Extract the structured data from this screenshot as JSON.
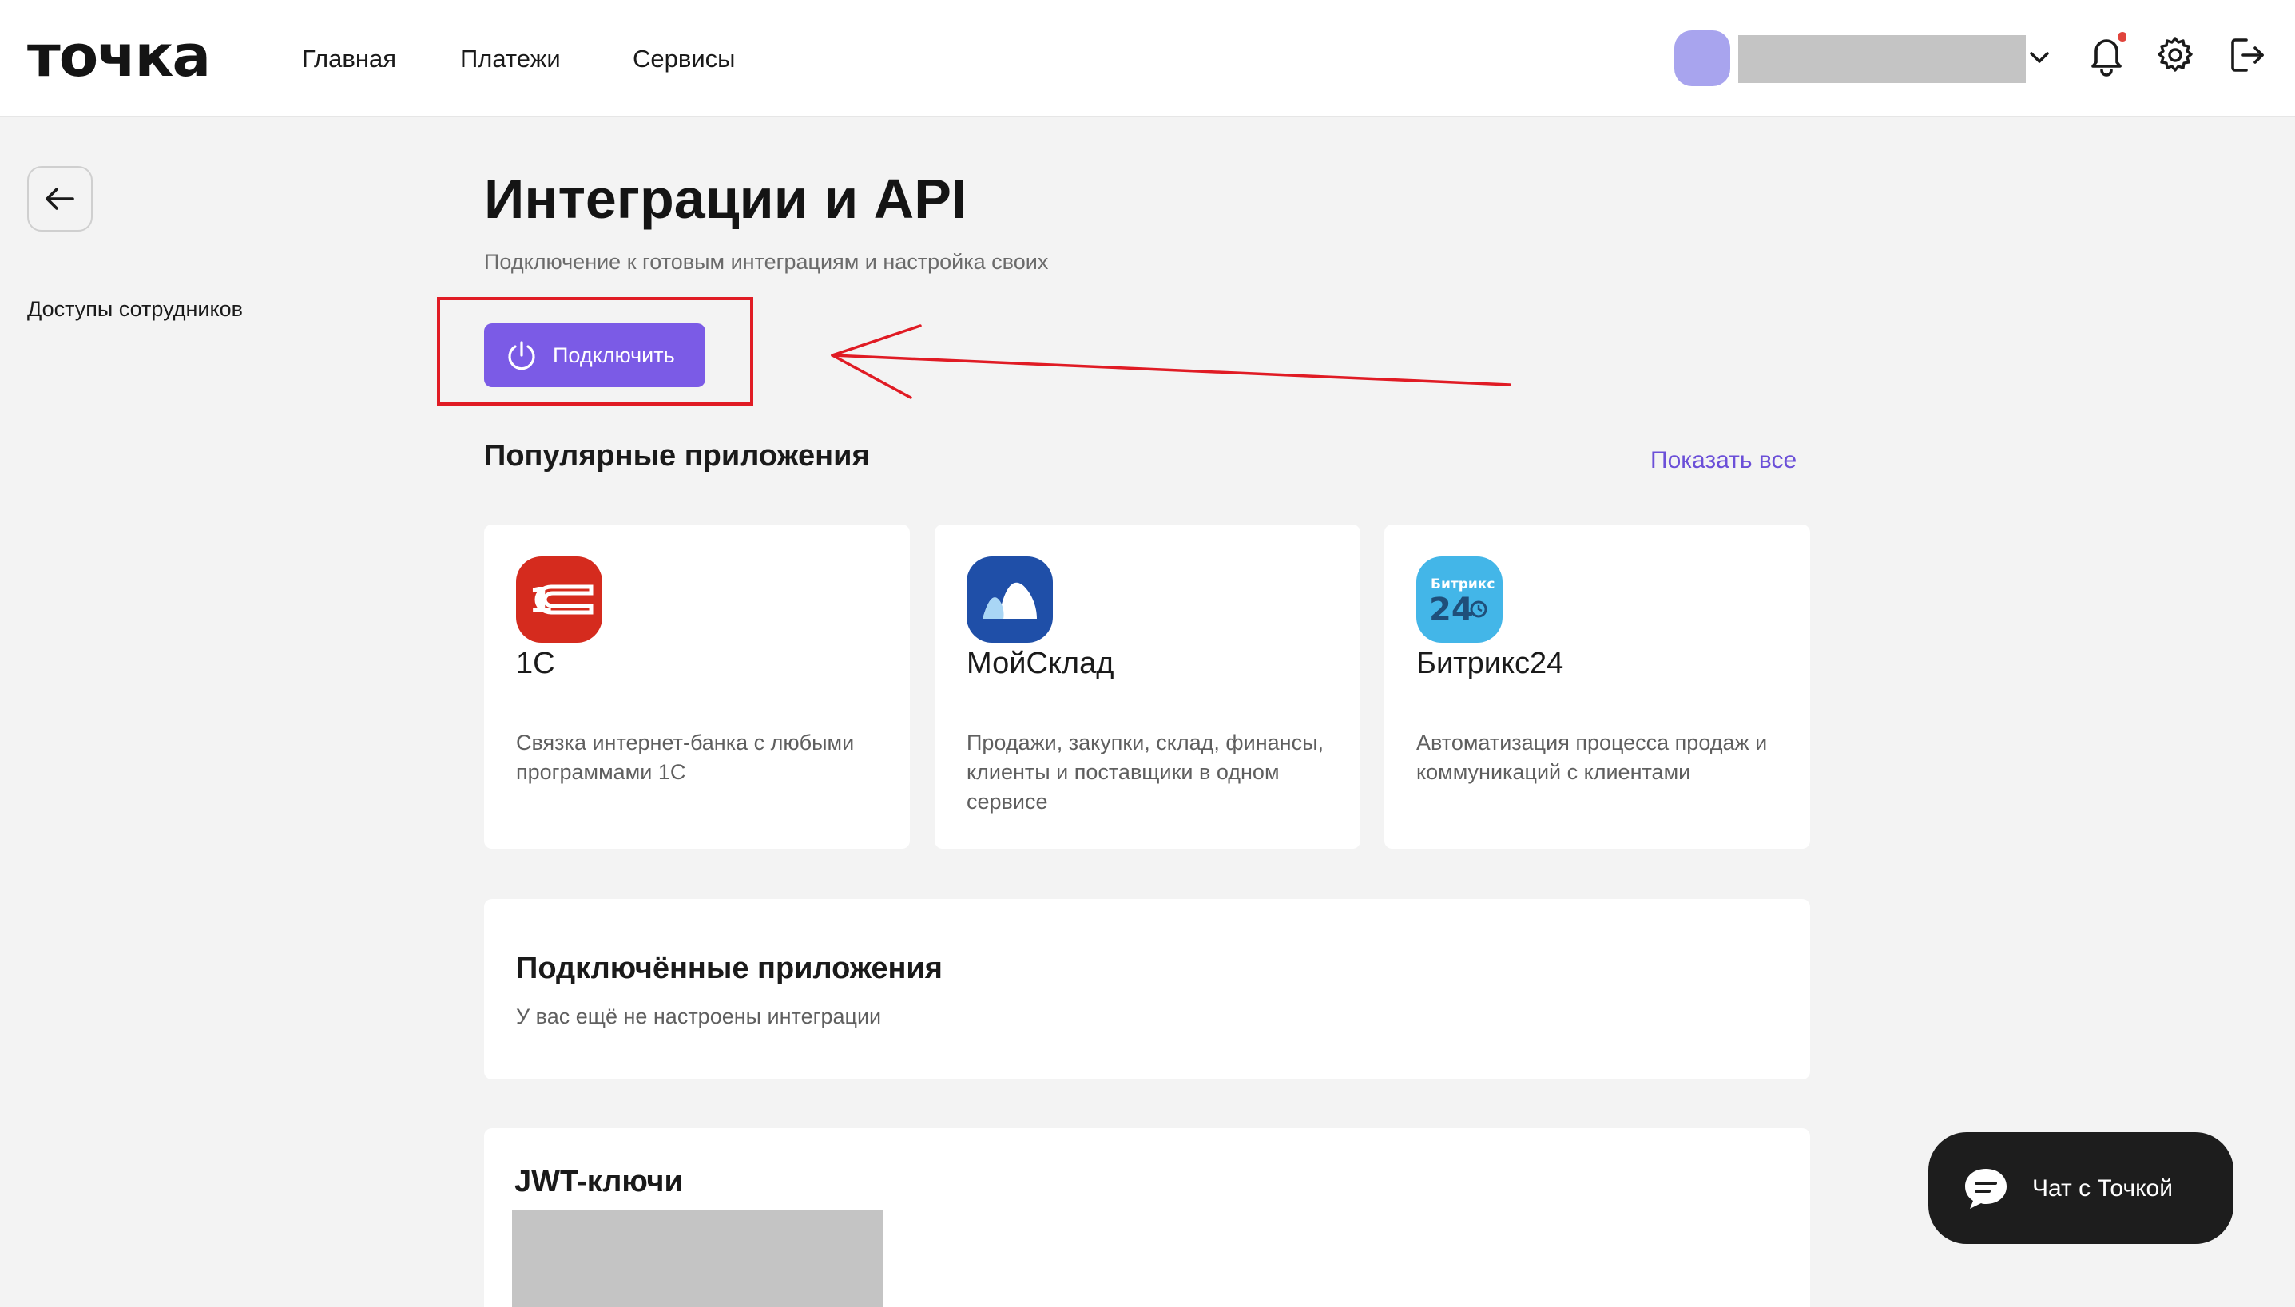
{
  "header": {
    "logo": "точка",
    "nav": [
      "Главная",
      "Платежи",
      "Сервисы"
    ],
    "account_name": "",
    "notification_dot_color": "#e0443c"
  },
  "sidebar": {
    "items": [
      "Доступы сотрудников"
    ]
  },
  "page": {
    "title": "Интеграции и API",
    "subtitle": "Подключение к готовым интеграциям и настройка своих",
    "connect_button": "Подключить",
    "accent_color": "#7b5be6"
  },
  "popular": {
    "title": "Популярные приложения",
    "show_all": "Показать все",
    "apps": [
      {
        "name": "1С",
        "description": "Связка интернет-банка с любыми программами 1С",
        "icon": "1c-logo-icon",
        "color": "#d52b1e"
      },
      {
        "name": "МойСклад",
        "description": "Продажи, закупки, склад, финансы, клиенты и поставщики в одном сервисе",
        "icon": "moysklad-logo-icon",
        "color": "#1f4fa8"
      },
      {
        "name": "Битрикс24",
        "description": "Автоматизация процесса продаж и коммуникаций с клиентами",
        "icon": "bitrix24-logo-icon",
        "color": "#43b6e8",
        "logo_text_top": "Битрикс",
        "logo_text_bottom": "24"
      }
    ]
  },
  "connected": {
    "title": "Подключённые приложения",
    "empty_text": "У вас ещё не настроены интеграции"
  },
  "jwt": {
    "title": "JWT-ключи"
  },
  "chat": {
    "label": "Чат с Точкой"
  }
}
